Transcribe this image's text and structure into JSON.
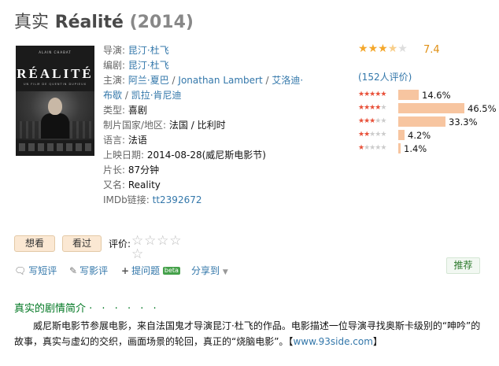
{
  "title": {
    "cn": "真实",
    "name": "Réalité",
    "year": "(2014)"
  },
  "poster": {
    "top_text": "ALAIN CHABAT",
    "title": "RÉALITÉ",
    "sub": "UN FILM DE QUENTIN DUPIEUX"
  },
  "info": {
    "director_label": "导演:",
    "director": "昆汀·杜飞",
    "writer_label": "编剧:",
    "writer": "昆汀·杜飞",
    "cast_label": "主演:",
    "cast1": "阿兰·夏巴",
    "cast2": "Jonathan Lambert",
    "cast3": "艾洛迪·",
    "cast3b": "布歇",
    "cast4": "凯拉·肯尼迪",
    "genre_label": "类型:",
    "genre": "喜剧",
    "country_label": "制片国家/地区:",
    "country": "法国 / 比利时",
    "language_label": "语言:",
    "language": "法语",
    "release_label": "上映日期:",
    "release": "2014-08-28(威尼斯电影节)",
    "runtime_label": "片长:",
    "runtime": "87分钟",
    "aka_label": "又名:",
    "aka": "Reality",
    "imdb_label": "IMDb链接:",
    "imdb": "tt2392672"
  },
  "rating": {
    "score": "7.4",
    "stars_value": 3.7,
    "votes": "(152人评价)",
    "distribution": [
      {
        "stars": 5,
        "pct": "14.6%",
        "value": 14.6
      },
      {
        "stars": 4,
        "pct": "46.5%",
        "value": 46.5
      },
      {
        "stars": 3,
        "pct": "33.3%",
        "value": 33.3
      },
      {
        "stars": 2,
        "pct": "4.2%",
        "value": 4.2
      },
      {
        "stars": 1,
        "pct": "1.4%",
        "value": 1.4
      }
    ]
  },
  "buttons": {
    "want": "想看",
    "seen": "看过",
    "rate_label": "评价:"
  },
  "actions": {
    "short_review": "写短评",
    "review": "写影评",
    "question": "提问题",
    "beta": "beta",
    "share": "分享到",
    "recommend": "推荐"
  },
  "synopsis": {
    "heading": "真实的剧情简介",
    "dots": "· · · · · ·",
    "text": "威尼斯电影节参展电影，来自法国鬼才导演昆汀·杜飞的作品。电影描述一位导演寻找奥斯卡级别的“呻吟”的故事，真实与虚幻的交织，画面场景的轮回，真正的“烧脑电影”。【",
    "link": "www.93side.com",
    "end": "】"
  },
  "colors": {
    "star": "#f4a72b",
    "bar": "#f7c5a0",
    "link": "#3377aa",
    "green": "#007722"
  }
}
